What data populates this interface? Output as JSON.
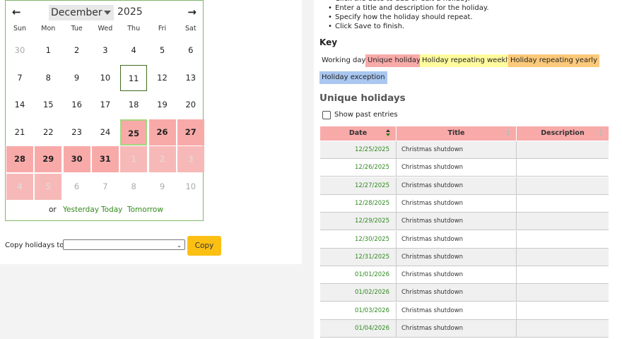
{
  "calendar": {
    "prev_icon": "←",
    "next_icon": "→",
    "month": "December",
    "year": "2025",
    "weekdays": [
      "Sun",
      "Mon",
      "Tue",
      "Wed",
      "Thu",
      "Fri",
      "Sat"
    ],
    "weeks": [
      [
        {
          "d": "30",
          "other": true
        },
        {
          "d": "1"
        },
        {
          "d": "2"
        },
        {
          "d": "3"
        },
        {
          "d": "4"
        },
        {
          "d": "5"
        },
        {
          "d": "6"
        }
      ],
      [
        {
          "d": "7"
        },
        {
          "d": "8"
        },
        {
          "d": "9"
        },
        {
          "d": "10"
        },
        {
          "d": "11",
          "today": true
        },
        {
          "d": "12"
        },
        {
          "d": "13"
        }
      ],
      [
        {
          "d": "14"
        },
        {
          "d": "15"
        },
        {
          "d": "16"
        },
        {
          "d": "17"
        },
        {
          "d": "18"
        },
        {
          "d": "19"
        },
        {
          "d": "20"
        }
      ],
      [
        {
          "d": "21"
        },
        {
          "d": "22"
        },
        {
          "d": "23"
        },
        {
          "d": "24"
        },
        {
          "d": "25",
          "holiday": true,
          "selected": true
        },
        {
          "d": "26",
          "holiday": true
        },
        {
          "d": "27",
          "holiday": true
        }
      ],
      [
        {
          "d": "28",
          "holiday": true
        },
        {
          "d": "29",
          "holiday": true
        },
        {
          "d": "30",
          "holiday": true
        },
        {
          "d": "31",
          "holiday": true
        },
        {
          "d": "1",
          "other": true,
          "holiday": true
        },
        {
          "d": "2",
          "other": true,
          "holiday": true
        },
        {
          "d": "3",
          "other": true,
          "holiday": true
        }
      ],
      [
        {
          "d": "4",
          "other": true,
          "holiday": true
        },
        {
          "d": "5",
          "other": true,
          "holiday": true
        },
        {
          "d": "6",
          "other": true
        },
        {
          "d": "7",
          "other": true
        },
        {
          "d": "8",
          "other": true
        },
        {
          "d": "9",
          "other": true
        },
        {
          "d": "10",
          "other": true
        }
      ]
    ],
    "footer": {
      "or": "or",
      "yesterday": "Yesterday",
      "today": "Today",
      "tomorrow": "Tomorrow"
    }
  },
  "copy": {
    "label": "Copy holidays to:",
    "selected": "",
    "button": "Copy"
  },
  "instructions": [
    "Click the date to add or edit a holiday.",
    "Enter a title and description for the holiday.",
    "Specify how the holiday should repeat.",
    "Click Save to finish."
  ],
  "key": {
    "title": "Key",
    "items": [
      {
        "label": "Working day",
        "color": "#ffffff"
      },
      {
        "label": "Unique holiday",
        "color": "#f8aaa9"
      },
      {
        "label": "Holiday repeating weekly",
        "color": "#fffb9e"
      },
      {
        "label": "Holiday repeating yearly",
        "color": "#fcc97a"
      },
      {
        "label": "Holiday exception",
        "color": "#a9c7f0"
      }
    ]
  },
  "unique_holidays": {
    "title": "Unique holidays",
    "show_past_label": "Show past entries",
    "show_past_checked": false,
    "columns": [
      "Date",
      "Title",
      "Description"
    ],
    "rows": [
      {
        "date": "12/25/2025",
        "title": "Christmas shutdown",
        "description": ""
      },
      {
        "date": "12/26/2025",
        "title": "Christmas shutdown",
        "description": ""
      },
      {
        "date": "12/27/2025",
        "title": "Christmas shutdown",
        "description": ""
      },
      {
        "date": "12/28/2025",
        "title": "Christmas shutdown",
        "description": ""
      },
      {
        "date": "12/29/2025",
        "title": "Christmas shutdown",
        "description": ""
      },
      {
        "date": "12/30/2025",
        "title": "Christmas shutdown",
        "description": ""
      },
      {
        "date": "12/31/2025",
        "title": "Christmas shutdown",
        "description": ""
      },
      {
        "date": "01/01/2026",
        "title": "Christmas shutdown",
        "description": ""
      },
      {
        "date": "01/02/2026",
        "title": "Christmas shutdown",
        "description": ""
      },
      {
        "date": "01/03/2026",
        "title": "Christmas shutdown",
        "description": ""
      },
      {
        "date": "01/04/2026",
        "title": "Christmas shutdown",
        "description": ""
      }
    ]
  }
}
